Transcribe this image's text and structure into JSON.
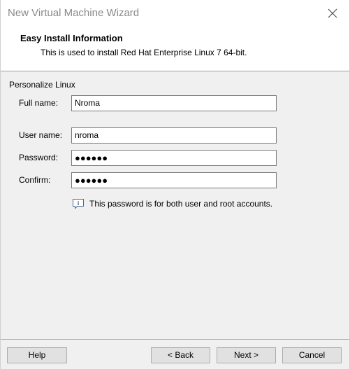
{
  "window": {
    "title": "New Virtual Machine Wizard",
    "close_icon": "close-icon"
  },
  "header": {
    "title": "Easy Install Information",
    "subtitle": "This is used to install Red Hat Enterprise Linux 7 64-bit."
  },
  "form": {
    "group_label": "Personalize Linux",
    "full_name_label": "Full name:",
    "full_name_value": "Nroma",
    "user_name_label": "User name:",
    "user_name_value": "nroma",
    "password_label": "Password:",
    "password_value": "●●●●●●",
    "confirm_label": "Confirm:",
    "confirm_value": "●●●●●●",
    "info_icon": "info-icon",
    "info_text": "This password is for both user and root accounts."
  },
  "buttons": {
    "help": "Help",
    "back": "< Back",
    "next": "Next >",
    "cancel": "Cancel"
  }
}
